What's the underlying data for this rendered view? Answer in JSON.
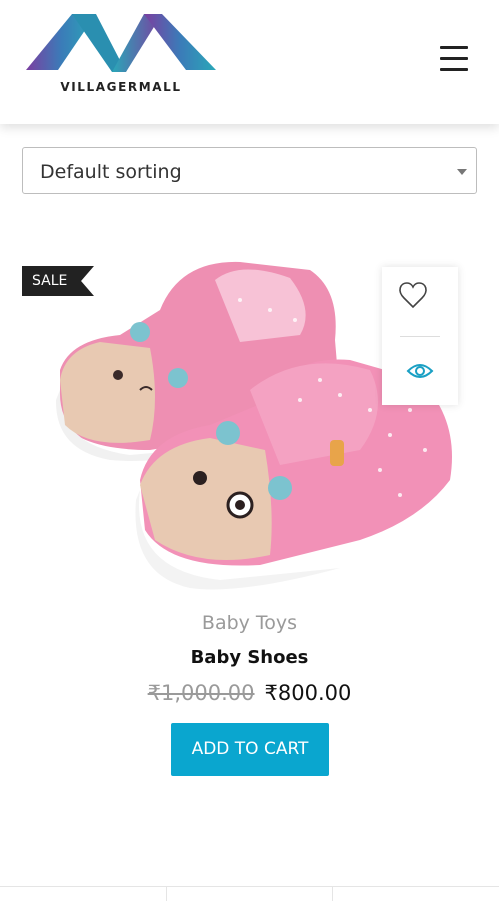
{
  "header": {
    "logo_text": "VILLAGERMALL",
    "menu_icon": "hamburger-menu-icon",
    "brand_gradient": [
      "#7b3fa0",
      "#2aa7b8"
    ]
  },
  "sorting": {
    "selected": "Default sorting"
  },
  "product": {
    "badge": "SALE",
    "category": "Baby Toys",
    "title": "Baby Shoes",
    "old_price": "₹1,000.00",
    "new_price": "₹800.00",
    "add_to_cart": "ADD TO CART",
    "wishlist_icon": "heart-icon",
    "quickview_icon": "eye-icon",
    "button_color": "#0aa6cf"
  }
}
